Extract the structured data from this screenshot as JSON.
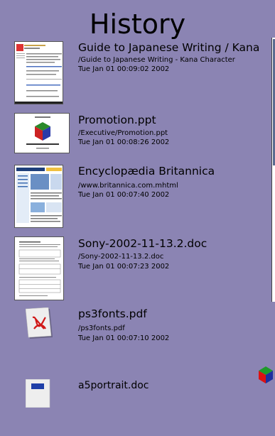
{
  "title": "History",
  "items": [
    {
      "name": "Guide to Japanese Writing / Kana",
      "path": "/Guide to Japanese Writing - Kana Character",
      "date": "Tue Jan 01 00:09:02 2002",
      "thumb": "web-page-thumbnail"
    },
    {
      "name": "Promotion.ppt",
      "path": "/Executive/Promotion.ppt",
      "date": "Tue Jan 01 00:08:26 2002",
      "thumb": "presentation-thumbnail"
    },
    {
      "name": "Encyclopædia Britannica",
      "path": "/www.britannica.com.mhtml",
      "date": "Tue Jan 01 00:07:40 2002",
      "thumb": "web-page-thumbnail"
    },
    {
      "name": "Sony-2002-11-13.2.doc",
      "path": "/Sony-2002-11-13.2.doc",
      "date": "Tue Jan 01 00:07:23 2002",
      "thumb": "document-thumbnail"
    },
    {
      "name": "ps3fonts.pdf",
      "path": "/ps3fonts.pdf",
      "date": "Tue Jan 01 00:07:10 2002",
      "thumb": "pdf-icon"
    },
    {
      "name": "a5portrait.doc",
      "path": "",
      "date": "",
      "thumb": "document-icon"
    }
  ],
  "colors": {
    "background": "#8b84b3",
    "text": "#000000"
  }
}
